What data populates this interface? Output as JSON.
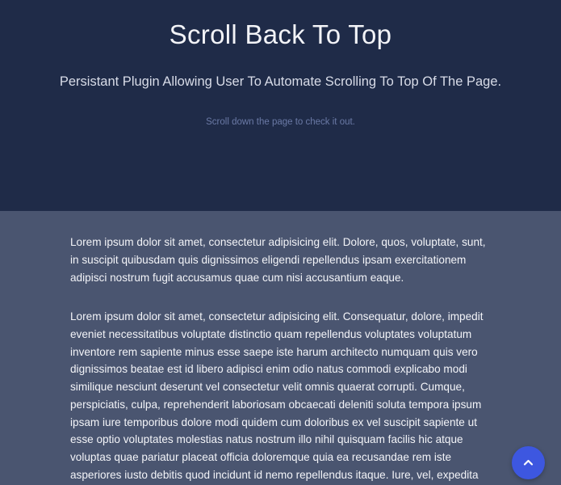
{
  "hero": {
    "title": "Scroll Back To Top",
    "subtitle": "Persistant Plugin Allowing User To Automate Scrolling To Top Of The Page.",
    "hint": "Scroll down the page to check it out."
  },
  "content": {
    "paragraphs": [
      "Lorem ipsum dolor sit amet, consectetur adipisicing elit. Dolore, quos, voluptate, sunt, in suscipit quibusdam quis dignissimos eligendi repellendus ipsam exercitationem adipisci nostrum fugit accusamus quae cum nisi accusantium eaque.",
      "Lorem ipsum dolor sit amet, consectetur adipisicing elit. Consequatur, dolore, impedit eveniet necessitatibus voluptate distinctio quam repellendus voluptates voluptatum inventore rem sapiente minus esse saepe iste harum architecto numquam quis vero dignissimos beatae est id libero adipisci enim odio natus commodi explicabo modi similique nesciunt deserunt vel consectetur velit omnis quaerat corrupti. Cumque, perspiciatis, culpa, reprehenderit laboriosam obcaecati deleniti soluta tempora ipsum ipsam iure temporibus dolore modi quidem cum doloribus ex vel suscipit sapiente ut esse optio voluptates molestias natus nostrum illo nihil quisquam facilis hic atque voluptas quae pariatur placeat officia doloremque quia ea recusandae rem iste asperiores iusto debitis quod incidunt id nemo repellendus itaque. Iure, vel, expedita"
    ]
  },
  "scroll_top_button": {
    "icon": "chevron-up-icon"
  },
  "colors": {
    "hero_background": "#1f2b48",
    "content_background": "#4a5570",
    "accent": "#3d57e0"
  }
}
